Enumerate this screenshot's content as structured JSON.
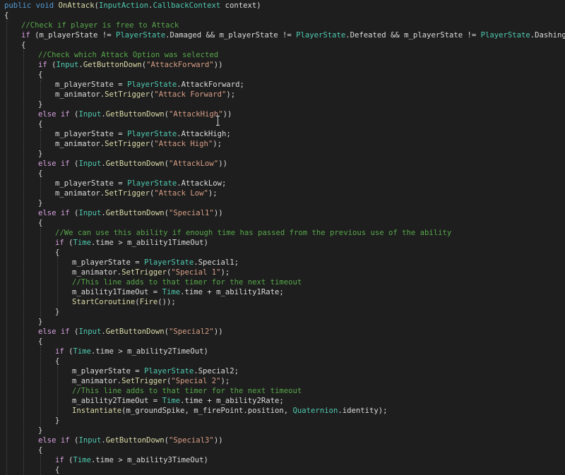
{
  "colors": {
    "background": "#1e1e1e",
    "keyword": "#569cd6",
    "control": "#d8a0df",
    "type": "#4ec9b0",
    "method": "#dcdcaa",
    "string": "#d69d85",
    "comment": "#57a64a",
    "plain": "#dcdcdc",
    "number": "#b5cea8"
  },
  "editor": {
    "lines": [
      {
        "indent": 0,
        "tokens": [
          [
            "public",
            "keyword"
          ],
          [
            " ",
            "plain"
          ],
          [
            "void",
            "keyword"
          ],
          [
            " ",
            "plain"
          ],
          [
            "OnAttack",
            "method"
          ],
          [
            "(",
            "plain"
          ],
          [
            "InputAction",
            "type"
          ],
          [
            ".",
            "plain"
          ],
          [
            "CallbackContext",
            "type"
          ],
          [
            " context)",
            "plain"
          ]
        ]
      },
      {
        "indent": 0,
        "tokens": [
          [
            "{",
            "plain"
          ]
        ]
      },
      {
        "indent": 1,
        "tokens": [
          [
            "//Check if player is free to Attack",
            "comment"
          ]
        ]
      },
      {
        "indent": 1,
        "tokens": [
          [
            "if",
            "control"
          ],
          [
            " (m_playerState != ",
            "plain"
          ],
          [
            "PlayerState",
            "type"
          ],
          [
            ".Damaged && m_playerState != ",
            "plain"
          ],
          [
            "PlayerState",
            "type"
          ],
          [
            ".Defeated && m_playerState != ",
            "plain"
          ],
          [
            "PlayerState",
            "type"
          ],
          [
            ".Dashing)",
            "plain"
          ]
        ]
      },
      {
        "indent": 1,
        "tokens": [
          [
            "{",
            "plain"
          ]
        ]
      },
      {
        "indent": 2,
        "tokens": [
          [
            "//Check which Attack Option was selected",
            "comment"
          ]
        ]
      },
      {
        "indent": 2,
        "tokens": [
          [
            "if",
            "control"
          ],
          [
            " (",
            "plain"
          ],
          [
            "Input",
            "type"
          ],
          [
            ".",
            "plain"
          ],
          [
            "GetButtonDown",
            "method"
          ],
          [
            "(",
            "plain"
          ],
          [
            "\"AttackForward\"",
            "string"
          ],
          [
            "))",
            "plain"
          ]
        ]
      },
      {
        "indent": 2,
        "tokens": [
          [
            "{",
            "plain"
          ]
        ]
      },
      {
        "indent": 3,
        "tokens": [
          [
            "m_playerState = ",
            "plain"
          ],
          [
            "PlayerState",
            "type"
          ],
          [
            ".AttackForward;",
            "plain"
          ]
        ]
      },
      {
        "indent": 3,
        "tokens": [
          [
            "m_animator.",
            "plain"
          ],
          [
            "SetTrigger",
            "method"
          ],
          [
            "(",
            "plain"
          ],
          [
            "\"Attack Forward\"",
            "string"
          ],
          [
            ");",
            "plain"
          ]
        ]
      },
      {
        "indent": 2,
        "tokens": [
          [
            "}",
            "plain"
          ]
        ]
      },
      {
        "indent": 2,
        "tokens": [
          [
            "else",
            "control"
          ],
          [
            " ",
            "plain"
          ],
          [
            "if",
            "control"
          ],
          [
            " (",
            "plain"
          ],
          [
            "Input",
            "type"
          ],
          [
            ".",
            "plain"
          ],
          [
            "GetButtonDown",
            "method"
          ],
          [
            "(",
            "plain"
          ],
          [
            "\"AttackHigh\"",
            "string"
          ],
          [
            "))",
            "plain"
          ]
        ]
      },
      {
        "indent": 2,
        "tokens": [
          [
            "{",
            "plain"
          ]
        ]
      },
      {
        "indent": 3,
        "tokens": [
          [
            "m_playerState = ",
            "plain"
          ],
          [
            "PlayerState",
            "type"
          ],
          [
            ".AttackHigh;",
            "plain"
          ]
        ]
      },
      {
        "indent": 3,
        "tokens": [
          [
            "m_animator.",
            "plain"
          ],
          [
            "SetTrigger",
            "method"
          ],
          [
            "(",
            "plain"
          ],
          [
            "\"Attack High\"",
            "string"
          ],
          [
            ");",
            "plain"
          ]
        ]
      },
      {
        "indent": 2,
        "tokens": [
          [
            "}",
            "plain"
          ]
        ]
      },
      {
        "indent": 2,
        "tokens": [
          [
            "else",
            "control"
          ],
          [
            " ",
            "plain"
          ],
          [
            "if",
            "control"
          ],
          [
            " (",
            "plain"
          ],
          [
            "Input",
            "type"
          ],
          [
            ".",
            "plain"
          ],
          [
            "GetButtonDown",
            "method"
          ],
          [
            "(",
            "plain"
          ],
          [
            "\"AttackLow\"",
            "string"
          ],
          [
            "))",
            "plain"
          ]
        ]
      },
      {
        "indent": 2,
        "tokens": [
          [
            "{",
            "plain"
          ]
        ]
      },
      {
        "indent": 3,
        "tokens": [
          [
            "m_playerState = ",
            "plain"
          ],
          [
            "PlayerState",
            "type"
          ],
          [
            ".AttackLow;",
            "plain"
          ]
        ]
      },
      {
        "indent": 3,
        "tokens": [
          [
            "m_animator.",
            "plain"
          ],
          [
            "SetTrigger",
            "method"
          ],
          [
            "(",
            "plain"
          ],
          [
            "\"Attack Low\"",
            "string"
          ],
          [
            ");",
            "plain"
          ]
        ]
      },
      {
        "indent": 2,
        "tokens": [
          [
            "}",
            "plain"
          ]
        ]
      },
      {
        "indent": 2,
        "tokens": [
          [
            "else",
            "control"
          ],
          [
            " ",
            "plain"
          ],
          [
            "if",
            "control"
          ],
          [
            " (",
            "plain"
          ],
          [
            "Input",
            "type"
          ],
          [
            ".",
            "plain"
          ],
          [
            "GetButtonDown",
            "method"
          ],
          [
            "(",
            "plain"
          ],
          [
            "\"Special1\"",
            "string"
          ],
          [
            "))",
            "plain"
          ]
        ]
      },
      {
        "indent": 2,
        "tokens": [
          [
            "{",
            "plain"
          ]
        ]
      },
      {
        "indent": 3,
        "tokens": [
          [
            "//We can use this ability if enough time has passed from the previous use of the ability",
            "comment"
          ]
        ]
      },
      {
        "indent": 3,
        "tokens": [
          [
            "if",
            "control"
          ],
          [
            " (",
            "plain"
          ],
          [
            "Time",
            "type"
          ],
          [
            ".time > m_ability1TimeOut)",
            "plain"
          ]
        ]
      },
      {
        "indent": 3,
        "tokens": [
          [
            "{",
            "plain"
          ]
        ]
      },
      {
        "indent": 4,
        "tokens": [
          [
            "m_playerState = ",
            "plain"
          ],
          [
            "PlayerState",
            "type"
          ],
          [
            ".Special1;",
            "plain"
          ]
        ]
      },
      {
        "indent": 4,
        "tokens": [
          [
            "m_animator.",
            "plain"
          ],
          [
            "SetTrigger",
            "method"
          ],
          [
            "(",
            "plain"
          ],
          [
            "\"Special 1\"",
            "string"
          ],
          [
            ");",
            "plain"
          ]
        ]
      },
      {
        "indent": 4,
        "tokens": [
          [
            "//This line adds to that timer for the next timeout",
            "comment"
          ]
        ]
      },
      {
        "indent": 4,
        "tokens": [
          [
            "m_ability1TimeOut = ",
            "plain"
          ],
          [
            "Time",
            "type"
          ],
          [
            ".time + m_ability1Rate;",
            "plain"
          ]
        ]
      },
      {
        "indent": 4,
        "tokens": [
          [
            "StartCoroutine",
            "method"
          ],
          [
            "(",
            "plain"
          ],
          [
            "Fire",
            "method"
          ],
          [
            "());",
            "plain"
          ]
        ]
      },
      {
        "indent": 3,
        "tokens": [
          [
            "}",
            "plain"
          ]
        ]
      },
      {
        "indent": 2,
        "tokens": [
          [
            "}",
            "plain"
          ]
        ]
      },
      {
        "indent": 2,
        "tokens": [
          [
            "else",
            "control"
          ],
          [
            " ",
            "plain"
          ],
          [
            "if",
            "control"
          ],
          [
            " (",
            "plain"
          ],
          [
            "Input",
            "type"
          ],
          [
            ".",
            "plain"
          ],
          [
            "GetButtonDown",
            "method"
          ],
          [
            "(",
            "plain"
          ],
          [
            "\"Special2\"",
            "string"
          ],
          [
            "))",
            "plain"
          ]
        ]
      },
      {
        "indent": 2,
        "tokens": [
          [
            "{",
            "plain"
          ]
        ]
      },
      {
        "indent": 3,
        "tokens": [
          [
            "if",
            "control"
          ],
          [
            " (",
            "plain"
          ],
          [
            "Time",
            "type"
          ],
          [
            ".time > m_ability2TimeOut)",
            "plain"
          ]
        ]
      },
      {
        "indent": 3,
        "tokens": [
          [
            "{",
            "plain"
          ]
        ]
      },
      {
        "indent": 4,
        "tokens": [
          [
            "m_playerState = ",
            "plain"
          ],
          [
            "PlayerState",
            "type"
          ],
          [
            ".Special2;",
            "plain"
          ]
        ]
      },
      {
        "indent": 4,
        "tokens": [
          [
            "m_animator.",
            "plain"
          ],
          [
            "SetTrigger",
            "method"
          ],
          [
            "(",
            "plain"
          ],
          [
            "\"Special 2\"",
            "string"
          ],
          [
            ");",
            "plain"
          ]
        ]
      },
      {
        "indent": 4,
        "tokens": [
          [
            "//This line adds to that timer for the next timeout",
            "comment"
          ]
        ]
      },
      {
        "indent": 4,
        "tokens": [
          [
            "m_ability2TimeOut = ",
            "plain"
          ],
          [
            "Time",
            "type"
          ],
          [
            ".time + m_ability2Rate;",
            "plain"
          ]
        ]
      },
      {
        "indent": 4,
        "tokens": [
          [
            "Instantiate",
            "method"
          ],
          [
            "(m_groundSpike, m_firePoint.position, ",
            "plain"
          ],
          [
            "Quaternion",
            "type"
          ],
          [
            ".identity);",
            "plain"
          ]
        ]
      },
      {
        "indent": 3,
        "tokens": [
          [
            "}",
            "plain"
          ]
        ]
      },
      {
        "indent": 2,
        "tokens": [
          [
            "}",
            "plain"
          ]
        ]
      },
      {
        "indent": 2,
        "tokens": [
          [
            "else",
            "control"
          ],
          [
            " ",
            "plain"
          ],
          [
            "if",
            "control"
          ],
          [
            " (",
            "plain"
          ],
          [
            "Input",
            "type"
          ],
          [
            ".",
            "plain"
          ],
          [
            "GetButtonDown",
            "method"
          ],
          [
            "(",
            "plain"
          ],
          [
            "\"Special3\"",
            "string"
          ],
          [
            "))",
            "plain"
          ]
        ]
      },
      {
        "indent": 2,
        "tokens": [
          [
            "{",
            "plain"
          ]
        ]
      },
      {
        "indent": 3,
        "tokens": [
          [
            "if",
            "control"
          ],
          [
            " (",
            "plain"
          ],
          [
            "Time",
            "type"
          ],
          [
            ".time > m_ability3TimeOut)",
            "plain"
          ]
        ]
      },
      {
        "indent": 3,
        "tokens": [
          [
            "{",
            "plain"
          ]
        ]
      }
    ]
  }
}
